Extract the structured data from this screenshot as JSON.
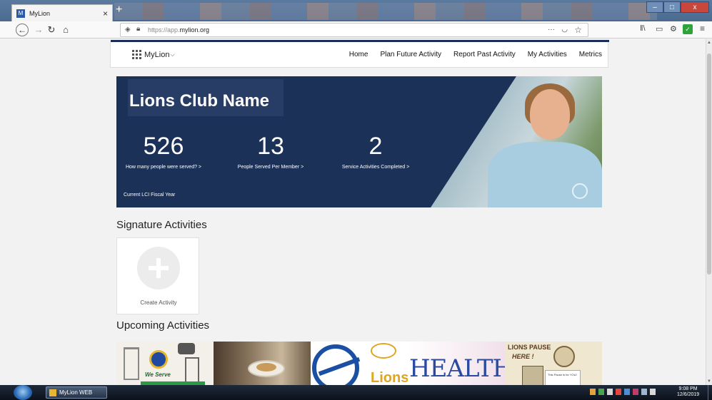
{
  "browser": {
    "tab_title": "MyLion",
    "tab_close": "×",
    "new_tab": "+",
    "url_prefix": "https://app.",
    "url_domain": "mylion.org",
    "url_dots": "···",
    "window_minimize": "–",
    "window_maximize": "□",
    "window_close": "x"
  },
  "site_header": {
    "brand": "MyLion",
    "brand_caret": "⌵",
    "menu": [
      "Home",
      "Plan Future Activity",
      "Report Past Activity",
      "My Activities",
      "Metrics"
    ]
  },
  "hero": {
    "club_name": "Lions Club Name",
    "stats": [
      {
        "value": "526",
        "label": "How many people were served? >"
      },
      {
        "value": "13",
        "label": "People Served Per Member >"
      },
      {
        "value": "2",
        "label": "Service Activities Completed >"
      }
    ],
    "fiscal_year": "Current LCI Fiscal Year"
  },
  "signature": {
    "title": "Signature Activities",
    "create_label": "Create Activity"
  },
  "upcoming": {
    "title": "Upcoming Activities",
    "thumb_texts": {
      "we_serve": "We Serve",
      "lions": "Lions",
      "health_fair": "HEALTHFAIR",
      "lions_pause": "LIONS PAUSE",
      "here": "HERE !",
      "note": "This Pause is for YOU!"
    }
  },
  "taskbar": {
    "task_label": "MyLion WEB",
    "time": "9:08 PM",
    "date": "12/6/2019"
  },
  "colors": {
    "hero_navy": "#1b3158",
    "header_accent": "#1a2c58",
    "tray_colors": [
      "#e5a13b",
      "#4aa34d",
      "#d8d8d8",
      "#e6433a",
      "#4a8fd8",
      "#c23b6a",
      "#9db6d0"
    ]
  }
}
